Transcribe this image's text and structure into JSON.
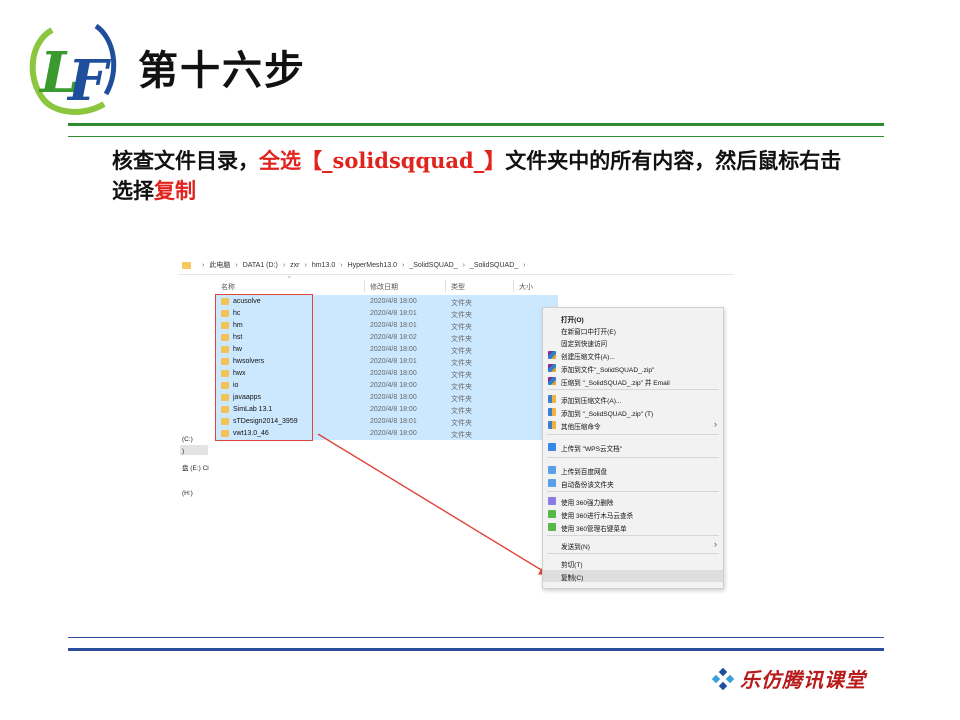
{
  "slide": {
    "title": "第十六步",
    "instruction": {
      "part1": "核查文件目录，",
      "part2_red": "全选【_solidsqquad_】",
      "part3": "文件夹中的所有内容，然后鼠标右击选择",
      "part4_red": "复制"
    },
    "footer_brand": "乐仿腾讯课堂"
  },
  "colors": {
    "accent_green": "#2e8b2e",
    "accent_red": "#e0231c",
    "footer_blue": "#2b4d9a",
    "selection": "#cce8ff"
  },
  "explorer": {
    "breadcrumb": [
      "此电脑",
      "DATA1 (D:)",
      "zxr",
      "hm13.0",
      "HyperMesh13.0",
      "_SolidSQUAD_",
      "_SolidSQUAD_"
    ],
    "columns": {
      "name": "名称",
      "date": "修改日期",
      "type": "类型",
      "size": "大小"
    },
    "rows": [
      {
        "name": "acusolve",
        "date": "2020/4/8 18:00",
        "type": "文件夹"
      },
      {
        "name": "hc",
        "date": "2020/4/8 18:01",
        "type": "文件夹"
      },
      {
        "name": "hm",
        "date": "2020/4/8 18:01",
        "type": "文件夹"
      },
      {
        "name": "hst",
        "date": "2020/4/8 18:02",
        "type": "文件夹"
      },
      {
        "name": "hw",
        "date": "2020/4/8 18:00",
        "type": "文件夹"
      },
      {
        "name": "hwsolvers",
        "date": "2020/4/8 18:01",
        "type": "文件夹"
      },
      {
        "name": "hwx",
        "date": "2020/4/8 18:00",
        "type": "文件夹"
      },
      {
        "name": "io",
        "date": "2020/4/8 18:00",
        "type": "文件夹"
      },
      {
        "name": "javaapps",
        "date": "2020/4/8 18:00",
        "type": "文件夹"
      },
      {
        "name": "SimLab 13.1",
        "date": "2020/4/8 18:00",
        "type": "文件夹"
      },
      {
        "name": "sTDesign2014_3959",
        "date": "2020/4/8 18:01",
        "type": "文件夹"
      },
      {
        "name": "vwt13.0_46",
        "date": "2020/4/8 18:00",
        "type": "文件夹"
      }
    ],
    "nav_fragments": [
      "(C:)",
      ")",
      "盘 (E:) Cl",
      "(H:)"
    ]
  },
  "context_menu": {
    "items": [
      {
        "label": "打开(O)",
        "bold": true,
        "icon": ""
      },
      {
        "label": "在新窗口中打开(E)",
        "icon": ""
      },
      {
        "label": "固定到快速访问",
        "icon": ""
      },
      {
        "label": "创建压缩文件(A)...",
        "icon": "winrar-icon"
      },
      {
        "label": "添加到文件\"_SolidSQUAD_.zip\"",
        "icon": "winrar-icon"
      },
      {
        "label": "压缩到 \"_SolidSQUAD_.zip\" 并 Email",
        "icon": "winrar-icon"
      },
      {
        "label": "添加到压缩文件(A)...",
        "icon": "archive-icon"
      },
      {
        "label": "添加到 \"_SolidSQUAD_.zip\" (T)",
        "icon": "archive-icon"
      },
      {
        "label": "其他压缩命令",
        "icon": "archive-icon",
        "submenu": true
      },
      {
        "label": "上传到 \"WPS云文档\"",
        "icon": "wps-cloud-icon"
      },
      {
        "label": "上传到百度网盘",
        "icon": "baidu-cloud-icon"
      },
      {
        "label": "自动备份该文件夹",
        "icon": "baidu-cloud-icon"
      },
      {
        "label": "使用 360强力删除",
        "icon": "360-delete-icon"
      },
      {
        "label": "使用 360进行木马云查杀",
        "icon": "360-icon"
      },
      {
        "label": "使用 360管理右键菜单",
        "icon": "360-icon"
      },
      {
        "label": "发送到(N)",
        "icon": "",
        "submenu": true
      },
      {
        "label": "剪切(T)",
        "icon": ""
      },
      {
        "label": "复制(C)",
        "icon": "",
        "highlighted": true
      }
    ]
  }
}
